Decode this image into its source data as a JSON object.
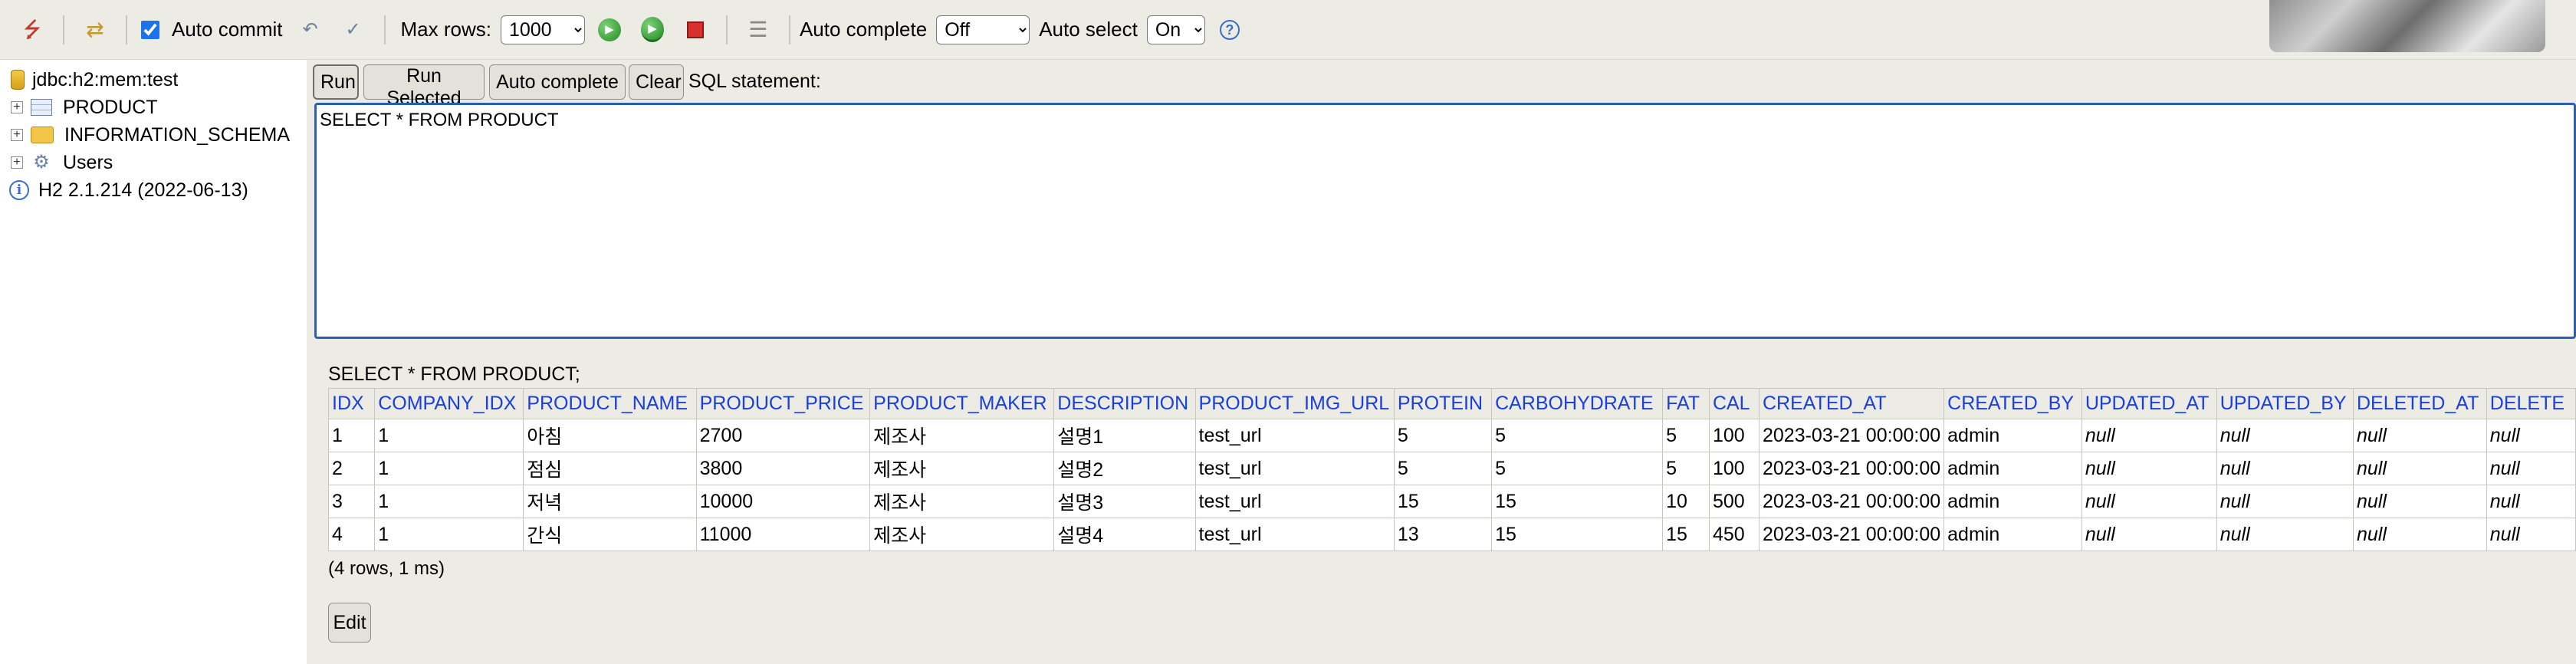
{
  "toolbar": {
    "auto_commit_label": "Auto commit",
    "max_rows_label": "Max rows:",
    "max_rows_value": "1000",
    "auto_complete_label": "Auto complete",
    "auto_complete_value": "Off",
    "auto_select_label": "Auto select",
    "auto_select_value": "On",
    "help_symbol": "?"
  },
  "tree": {
    "connection": "jdbc:h2:mem:test",
    "items": [
      {
        "label": "PRODUCT",
        "icon": "table-icon"
      },
      {
        "label": "INFORMATION_SCHEMA",
        "icon": "folder-icon"
      },
      {
        "label": "Users",
        "icon": "users-icon"
      }
    ],
    "version": "H2 2.1.214 (2022-06-13)"
  },
  "query": {
    "run_label": "Run",
    "run_selected_label": "Run Selected",
    "auto_complete_label": "Auto complete",
    "clear_label": "Clear",
    "sql_label": "SQL statement:",
    "sql_text": "SELECT * FROM PRODUCT"
  },
  "results": {
    "executed_sql": "SELECT * FROM PRODUCT;",
    "columns": [
      "IDX",
      "COMPANY_IDX",
      "PRODUCT_NAME",
      "PRODUCT_PRICE",
      "PRODUCT_MAKER",
      "DESCRIPTION",
      "PRODUCT_IMG_URL",
      "PROTEIN",
      "CARBOHYDRATE",
      "FAT",
      "CAL",
      "CREATED_AT",
      "CREATED_BY",
      "UPDATED_AT",
      "UPDATED_BY",
      "DELETED_AT",
      "DELETE"
    ],
    "rows": [
      [
        "1",
        "1",
        "아침",
        "2700",
        "제조사",
        "설명1",
        "test_url",
        "5",
        "5",
        "5",
        "100",
        "2023-03-21 00:00:00",
        "admin",
        "null",
        "null",
        "null",
        "null"
      ],
      [
        "2",
        "1",
        "점심",
        "3800",
        "제조사",
        "설명2",
        "test_url",
        "5",
        "5",
        "5",
        "100",
        "2023-03-21 00:00:00",
        "admin",
        "null",
        "null",
        "null",
        "null"
      ],
      [
        "3",
        "1",
        "저녁",
        "10000",
        "제조사",
        "설명3",
        "test_url",
        "15",
        "15",
        "10",
        "500",
        "2023-03-21 00:00:00",
        "admin",
        "null",
        "null",
        "null",
        "null"
      ],
      [
        "4",
        "1",
        "간식",
        "11000",
        "제조사",
        "설명4",
        "test_url",
        "13",
        "15",
        "15",
        "450",
        "2023-03-21 00:00:00",
        "admin",
        "null",
        "null",
        "null",
        "null"
      ]
    ],
    "summary": "(4 rows, 1 ms)",
    "edit_label": "Edit"
  }
}
